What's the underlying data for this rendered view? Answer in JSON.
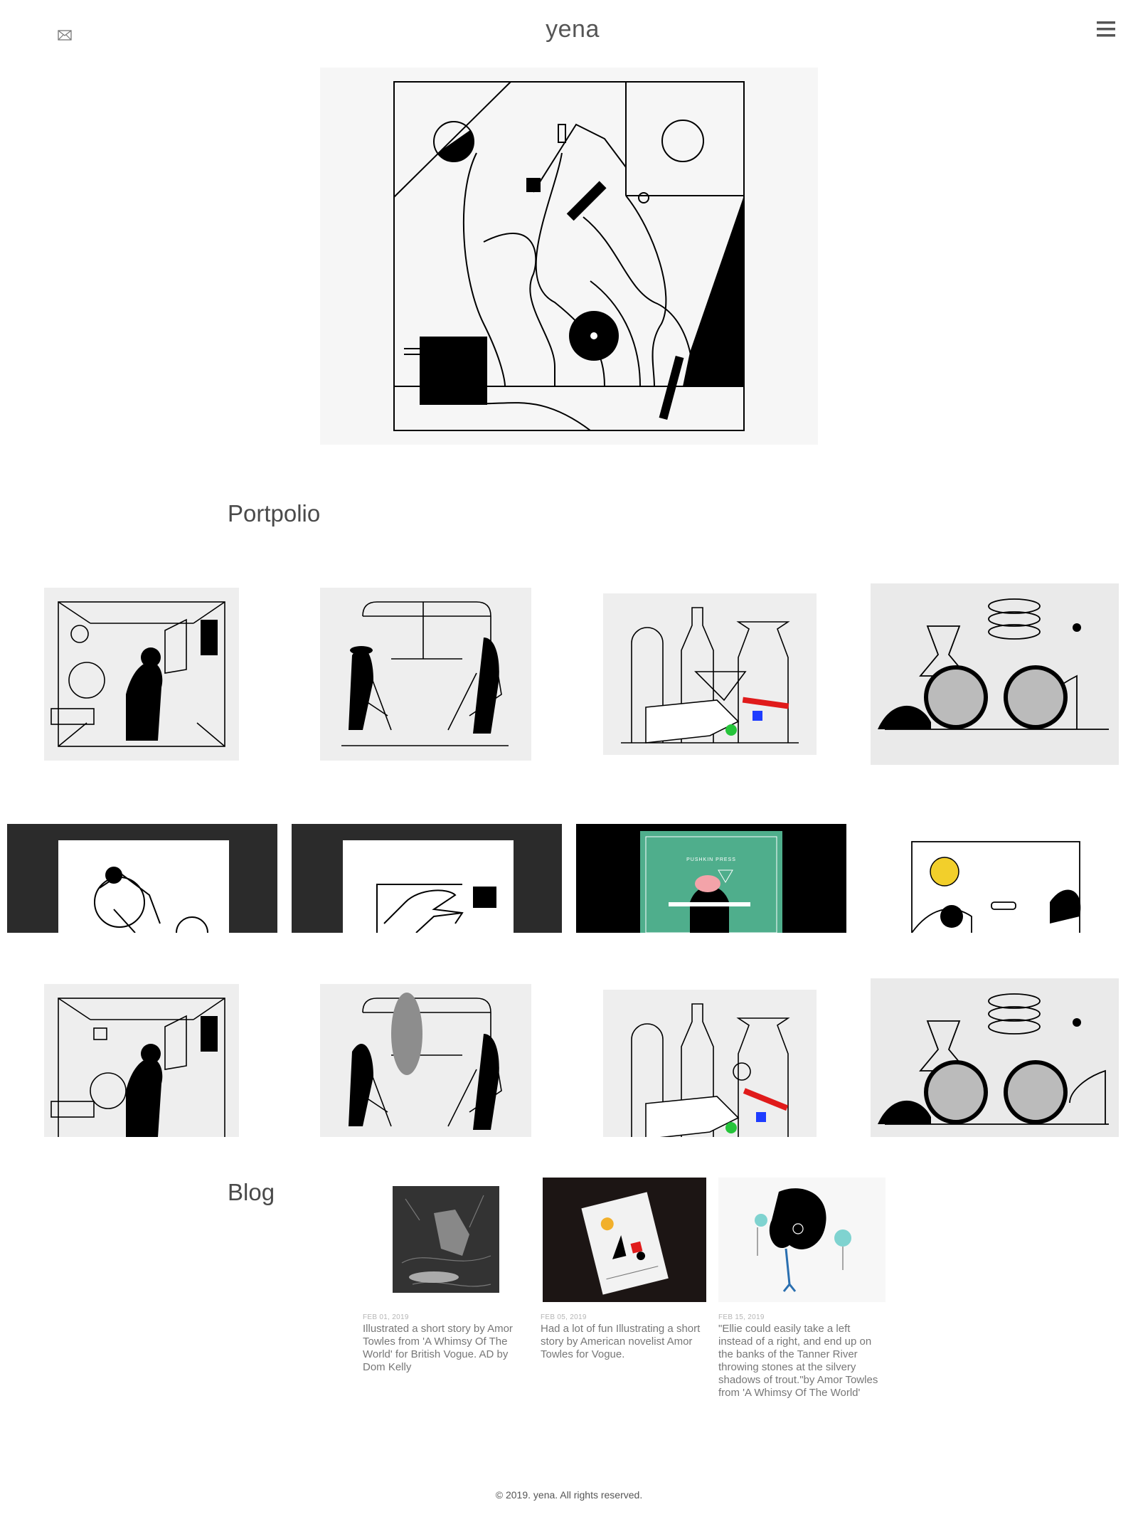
{
  "header": {
    "brand": "yena",
    "mail_icon": "envelope-icon",
    "menu_icon": "hamburger-menu-icon"
  },
  "hero": {
    "image": "abstract-line-illustration"
  },
  "portfolio": {
    "title": "Portpolio",
    "items": [
      {
        "image": "room-with-woman-illustration"
      },
      {
        "image": "train-passengers-illustration"
      },
      {
        "image": "bottles-and-hand-illustration"
      },
      {
        "image": "sunglasses-and-vases-illustration"
      },
      {
        "image": "cyclist-illustration"
      },
      {
        "image": "hand-holding-phone-illustration"
      },
      {
        "image": "pushkin-press-book-cover"
      },
      {
        "image": "car-window-sun-illustration"
      },
      {
        "image": "room-with-woman-illustration"
      },
      {
        "image": "train-passengers-illustration"
      },
      {
        "image": "bottles-and-hand-illustration"
      },
      {
        "image": "sunglasses-and-vases-illustration"
      }
    ],
    "book_label": "PUSHKIN PRESS"
  },
  "blog": {
    "title": "Blog",
    "posts": [
      {
        "date": "FEB 01, 2019",
        "text": "Illustrated a short story by Amor Towles from 'A Whimsy Of The World' for British Vogue. AD by Dom Kelly"
      },
      {
        "date": "FEB 05, 2019",
        "text": "Had a lot of fun Illustrating a short story by American novelist Amor Towles for Vogue."
      },
      {
        "date": "FEB 15, 2019",
        "text": "\"Ellie could easily take a left instead of a right, and end up on the banks of the Tanner River throwing stones at the silvery shadows of trout.\"by Amor Towles from 'A Whimsy Of The World'"
      }
    ]
  },
  "footer": {
    "copyright": "© 2019. yena. All rights reserved."
  },
  "colors": {
    "accent_green": "#4fae8c",
    "accent_red": "#e01b1b",
    "accent_blue": "#1e3cff",
    "accent_yellow": "#f2cf2b"
  }
}
